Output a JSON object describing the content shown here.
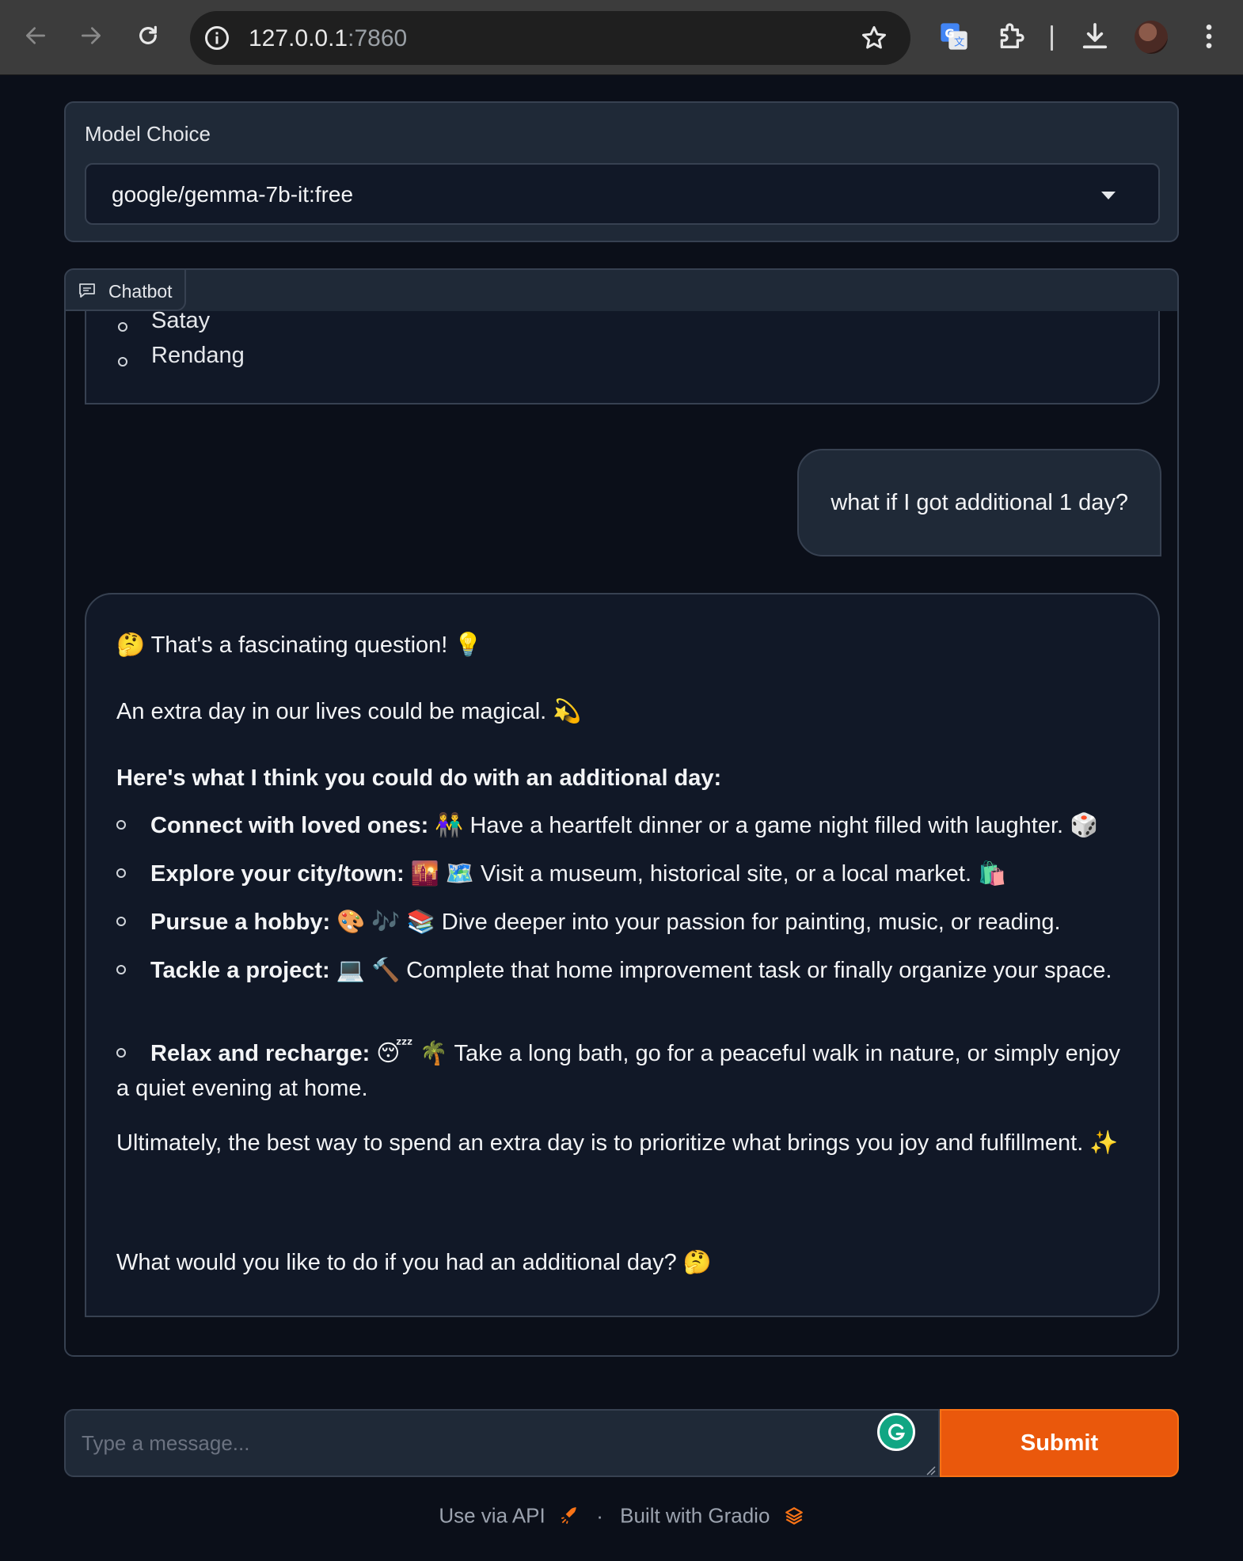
{
  "browser": {
    "url_host": "127.0.0.1",
    "url_port": ":7860"
  },
  "model": {
    "label": "Model Choice",
    "selected": "google/gemma-7b-it:free"
  },
  "chatbot": {
    "tab_label": "Chatbot",
    "previous_items": [
      "Satay",
      "Rendang"
    ],
    "user_message": "what if I got additional 1 day?",
    "bot": {
      "line1": "🤔 That's a fascinating question! 💡",
      "line2": "An extra day in our lives could be magical. 💫",
      "heading": "Here's what I think you could do with an additional day:",
      "items": [
        {
          "title": "Connect with loved ones:",
          "text": " 👫 Have a heartfelt dinner or a game night filled with laughter. 🎲"
        },
        {
          "title": "Explore your city/town:",
          "text": " 🌇 🗺️ Visit a museum, historical site, or a local market. 🛍️"
        },
        {
          "title": "Pursue a hobby:",
          "text": " 🎨 🎶 📚 Dive deeper into your passion for painting, music, or reading."
        },
        {
          "title": "Tackle a project:",
          "text": " 💻 🔨 Complete that home improvement task or finally organize your space."
        },
        {
          "title": "Relax and recharge:",
          "text": " 😴 🌴 Take a long bath, go for a peaceful walk in nature, or simply enjoy a quiet evening at home."
        }
      ],
      "closing": "Ultimately, the best way to spend an extra day is to prioritize what brings you joy and fulfillment. ✨",
      "question": "What would you like to do if you had an additional day? 🤔"
    }
  },
  "input": {
    "placeholder": "Type a message...",
    "submit_label": "Submit"
  },
  "footer": {
    "api_label": "Use via API",
    "separator": "·",
    "built_label": "Built with Gradio"
  },
  "colors": {
    "accent": "#ea580c",
    "background": "#0b0f19",
    "panel": "#1f2937"
  }
}
